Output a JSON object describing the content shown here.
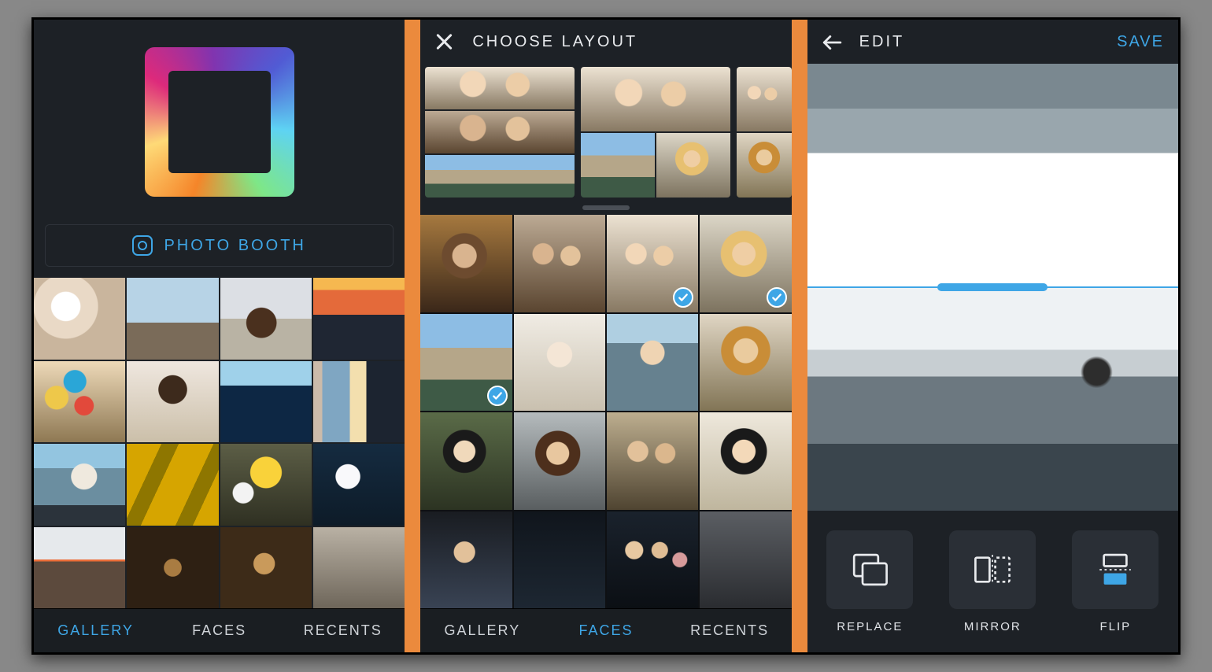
{
  "colors": {
    "accent": "#3ea6e6",
    "separator": "#eb8a3d",
    "bg": "#1d2126"
  },
  "screen1": {
    "photo_booth_label": "PHOTO BOOTH",
    "tabs": {
      "gallery": "GALLERY",
      "faces": "FACES",
      "recents": "RECENTS"
    },
    "active_tab": "gallery"
  },
  "screen2": {
    "title": "CHOOSE LAYOUT",
    "tabs": {
      "gallery": "GALLERY",
      "faces": "FACES",
      "recents": "RECENTS"
    },
    "active_tab": "faces",
    "selected_count": 3,
    "selected_indices": [
      2,
      3,
      4
    ]
  },
  "screen3": {
    "title": "EDIT",
    "save_label": "SAVE",
    "tools": {
      "replace": "REPLACE",
      "mirror": "MIRROR",
      "flip": "FLIP"
    },
    "selected_pane": "bottom"
  }
}
